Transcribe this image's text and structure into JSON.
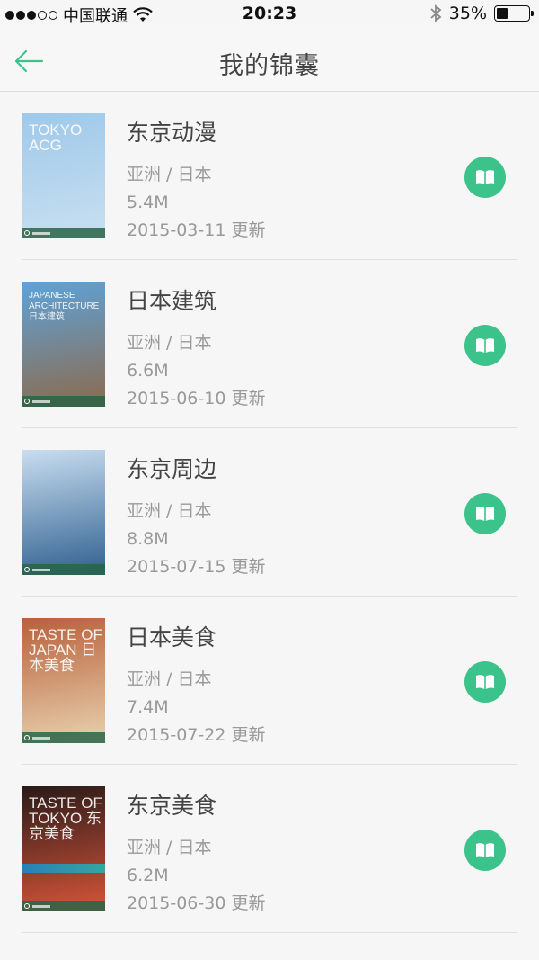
{
  "status_bar": {
    "carrier": "中国联通",
    "time": "20:23",
    "battery_percent": "35%",
    "battery_level": 0.35
  },
  "nav": {
    "title": "我的锦囊",
    "back_icon": "arrow-left-icon"
  },
  "guides": [
    {
      "name": "东京动漫",
      "region": "亚洲 / 日本",
      "size": "5.4M",
      "updated": "2015-03-11 更新",
      "cover_text": "TOKYO ACG",
      "cover_colors": [
        "#9fc9ea",
        "#c9dff0"
      ]
    },
    {
      "name": "日本建筑",
      "region": "亚洲 / 日本",
      "size": "6.6M",
      "updated": "2015-06-10 更新",
      "cover_text": "JAPANESE ARCHITECTURE 日本建筑",
      "cover_colors": [
        "#5ea3d9",
        "#8c6a4d"
      ]
    },
    {
      "name": "东京周边",
      "region": "亚洲 / 日本",
      "size": "8.8M",
      "updated": "2015-07-15 更新",
      "cover_text": "",
      "cover_colors": [
        "#c9def0",
        "#2f5f8f"
      ]
    },
    {
      "name": "日本美食",
      "region": "亚洲 / 日本",
      "size": "7.4M",
      "updated": "2015-07-22 更新",
      "cover_text": "TASTE OF JAPAN 日本美食",
      "cover_colors": [
        "#b8603a",
        "#e9d2b0"
      ]
    },
    {
      "name": "东京美食",
      "region": "亚洲 / 日本",
      "size": "6.2M",
      "updated": "2015-06-30 更新",
      "cover_text": "TASTE OF TOKYO 东京美食",
      "cover_colors": [
        "#2a1a18",
        "#d8553a"
      ]
    }
  ],
  "read_icon": "book-open-icon",
  "accent_color": "#3cc38b"
}
